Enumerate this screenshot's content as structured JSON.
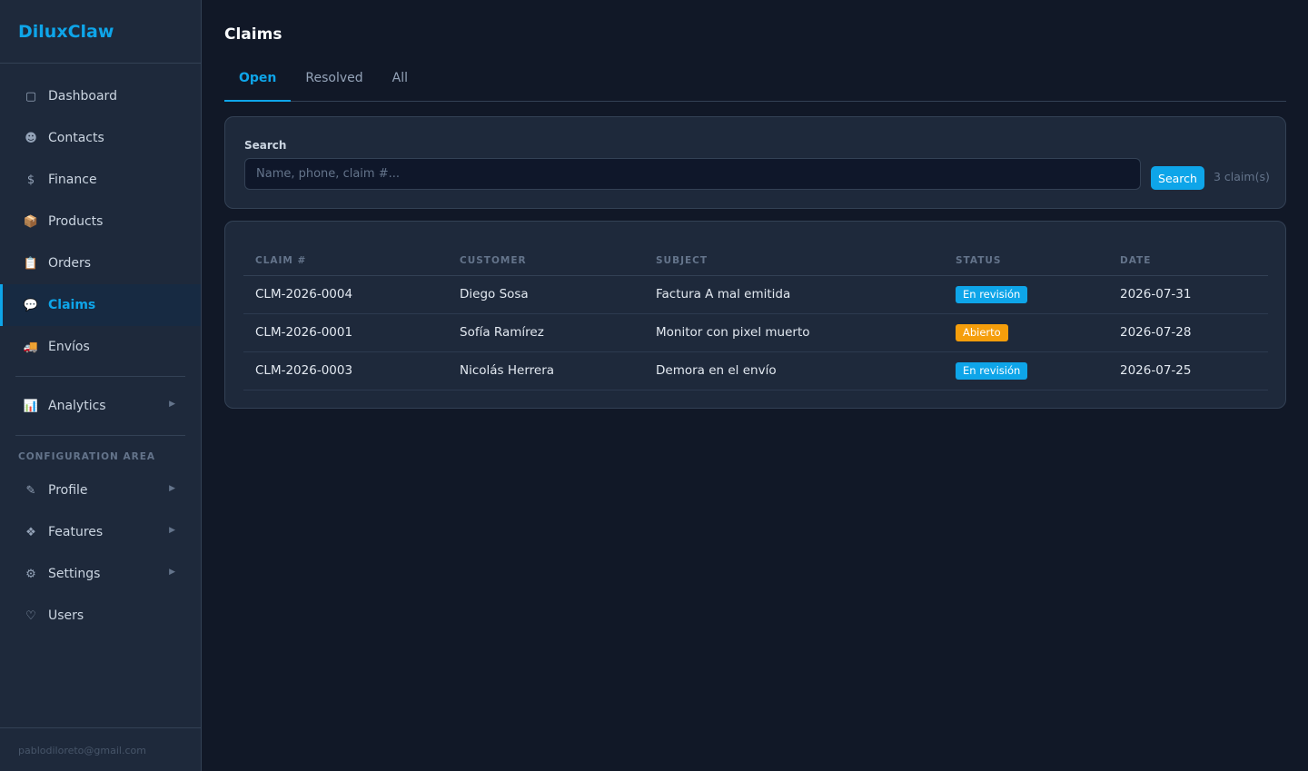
{
  "brand": "DiluxClaw",
  "sidebar": {
    "items": [
      {
        "label": "Dashboard",
        "icon": "square-icon",
        "glyph": "▢"
      },
      {
        "label": "Contacts",
        "icon": "user-icon",
        "glyph": "☻"
      },
      {
        "label": "Finance",
        "icon": "dollar-icon",
        "glyph": "$"
      },
      {
        "label": "Products",
        "icon": "package-icon",
        "glyph": "📦"
      },
      {
        "label": "Orders",
        "icon": "clipboard-icon",
        "glyph": "📋"
      },
      {
        "label": "Claims",
        "icon": "speech-bubble-icon",
        "glyph": "💬"
      },
      {
        "label": "Envíos",
        "icon": "truck-icon",
        "glyph": "🚚"
      }
    ],
    "analytics": {
      "label": "Analytics",
      "icon": "chart-icon",
      "glyph": "📊"
    },
    "config_label": "CONFIGURATION AREA",
    "config_items": [
      {
        "label": "Profile",
        "icon": "pencil-icon",
        "glyph": "✎"
      },
      {
        "label": "Features",
        "icon": "diamond-icon",
        "glyph": "❖"
      },
      {
        "label": "Settings",
        "icon": "gear-icon",
        "glyph": "⚙"
      },
      {
        "label": "Users",
        "icon": "shield-icon",
        "glyph": "♡"
      }
    ],
    "footer_email": "pablodiloreto@gmail.com"
  },
  "page": {
    "title": "Claims",
    "tabs": [
      "Open",
      "Resolved",
      "All"
    ]
  },
  "search": {
    "label": "Search",
    "placeholder": "Name, phone, claim #...",
    "value": "",
    "button_label": "Search",
    "count": "3 claim(s)"
  },
  "table": {
    "headers": [
      "CLAIM #",
      "CUSTOMER",
      "SUBJECT",
      "STATUS",
      "DATE"
    ],
    "rows": [
      {
        "claim": "CLM-2026-0004",
        "customer": "Diego Sosa",
        "subject": "Factura A mal emitida",
        "status": "En revisión",
        "date": "2026-07-31"
      },
      {
        "claim": "CLM-2026-0001",
        "customer": "Sofía Ramírez",
        "subject": "Monitor con pixel muerto",
        "status": "Abierto",
        "date": "2026-07-28"
      },
      {
        "claim": "CLM-2026-0003",
        "customer": "Nicolás Herrera",
        "subject": "Demora en el envío",
        "status": "En revisión",
        "date": "2026-07-25"
      }
    ]
  },
  "colors": {
    "accent": "#0ea5e9",
    "status_review": "#0ea5e9",
    "status_open": "#f59e0b",
    "background": "#111827",
    "sidebar": "#1e293b"
  }
}
